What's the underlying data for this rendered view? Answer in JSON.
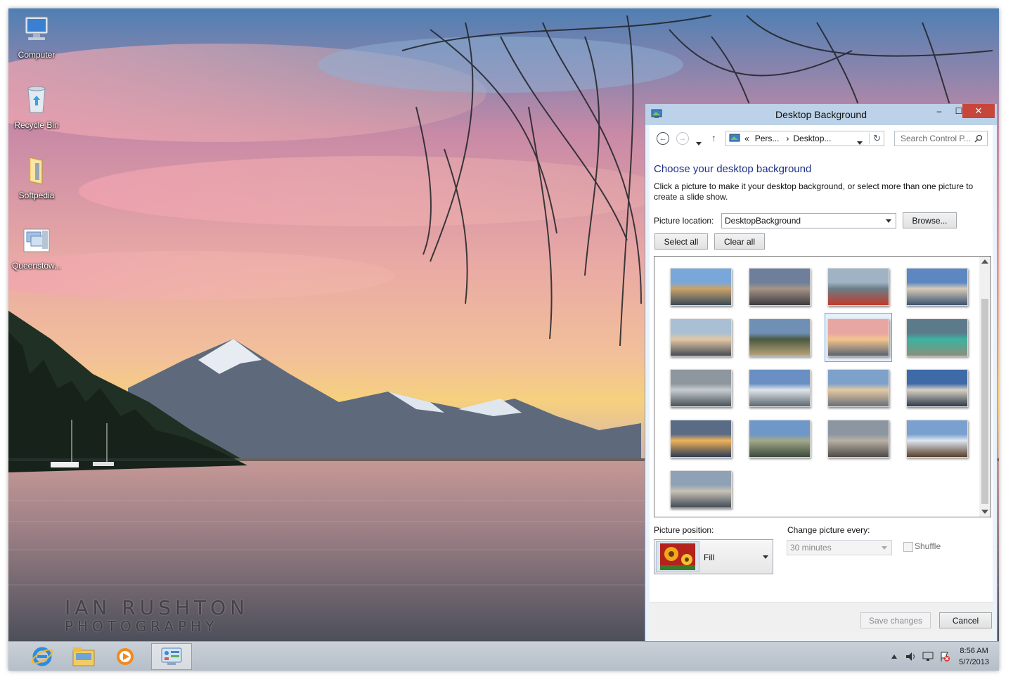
{
  "desktop": {
    "icons": [
      {
        "label": "Computer"
      },
      {
        "label": "Recycle Bin"
      },
      {
        "label": "Softpedia"
      },
      {
        "label": "Queenstow..."
      }
    ],
    "watermark_line1": "IAN RUSHTON",
    "watermark_line2": "PHOTOGRAPHY"
  },
  "taskbar": {
    "apps": [
      "internet-explorer",
      "file-explorer",
      "media-player",
      "control-panel"
    ],
    "active_app": "control-panel",
    "clock_time": "8:56 AM",
    "clock_date": "5/7/2013"
  },
  "window": {
    "title": "Desktop Background",
    "controls": {
      "minimize": "–",
      "maximize": "☐",
      "close": "✕"
    },
    "address": {
      "overflow": "«",
      "crumbs": [
        "Pers...",
        "Desktop..."
      ],
      "separator": "›"
    },
    "search_placeholder": "Search Control P...",
    "heading": "Choose your desktop background",
    "description": "Click a picture to make it your desktop background, or select more than one picture to create a slide show.",
    "picture_location_label": "Picture location:",
    "picture_location_value": "DesktopBackground",
    "browse_label": "Browse...",
    "select_all_label": "Select all",
    "clear_all_label": "Clear all",
    "thumbnails_count": 17,
    "selected_thumbnail_index": 6,
    "picture_position_label": "Picture position:",
    "picture_position_value": "Fill",
    "change_every_label": "Change picture every:",
    "change_every_value": "30 minutes",
    "shuffle_label": "Shuffle",
    "save_label": "Save changes",
    "cancel_label": "Cancel"
  },
  "colors": {
    "heading": "#1e3287",
    "titlebar": "#bcd2e8",
    "close": "#c7463c"
  }
}
